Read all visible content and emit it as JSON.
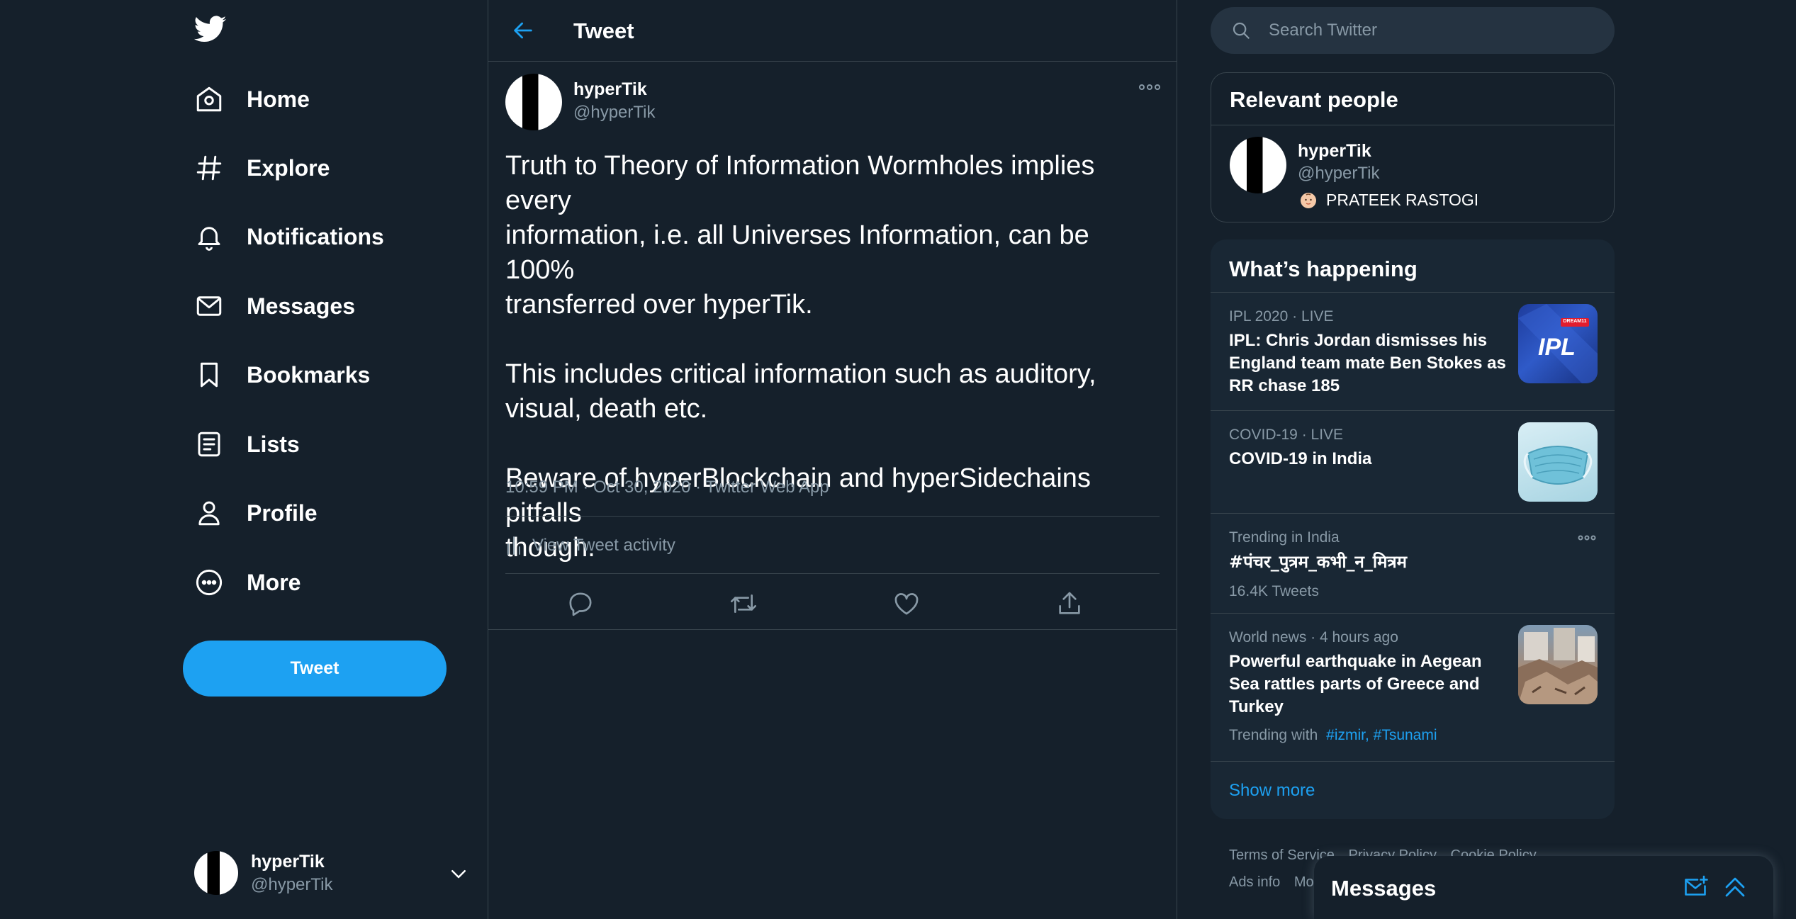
{
  "nav": {
    "items": [
      {
        "label": "Home",
        "icon": "home-icon"
      },
      {
        "label": "Explore",
        "icon": "hashtag-icon"
      },
      {
        "label": "Notifications",
        "icon": "bell-icon"
      },
      {
        "label": "Messages",
        "icon": "envelope-icon"
      },
      {
        "label": "Bookmarks",
        "icon": "bookmark-icon"
      },
      {
        "label": "Lists",
        "icon": "list-icon"
      },
      {
        "label": "Profile",
        "icon": "person-icon"
      },
      {
        "label": "More",
        "icon": "more-circle-icon"
      }
    ],
    "tweet_button": "Tweet",
    "account": {
      "name": "hyperTik",
      "handle": "@hyperTik"
    }
  },
  "center": {
    "title": "Tweet",
    "tweet": {
      "author_name": "hyperTik",
      "author_handle": "@hyperTik",
      "text": "Truth to Theory of Information Wormholes implies every\ninformation, i.e. all Universes Information, can be 100%\ntransferred over hyperTik.\n\nThis includes critical information such as auditory,\nvisual, death etc.\n\nBeware of hyperBlockchain and hyperSidechains pitfalls\nthough.",
      "meta": "10:59 PM · Oct 30, 2020 · Twitter Web App",
      "activity": "View Tweet activity"
    }
  },
  "right": {
    "search_placeholder": "Search Twitter",
    "relevant": {
      "title": "Relevant people",
      "name": "hyperTik",
      "handle": "@hyperTik",
      "bio": "PRATEEK RASTOGI"
    },
    "happening": {
      "title": "What’s happening",
      "trends": [
        {
          "context": "IPL 2020 · LIVE",
          "title": "IPL: Chris Jordan dismisses his England team mate Ben Stokes as RR chase 185",
          "thumb_text": "IPL",
          "thumb_badge": "DREAM11"
        },
        {
          "context": "COVID-19 · LIVE",
          "title": "COVID-19 in India"
        },
        {
          "context": "Trending in India",
          "title": "#पंचर_पुत्रम_कभी_न_मित्रम",
          "sub": "16.4K Tweets"
        },
        {
          "context": "World news · 4 hours ago",
          "title": "Powerful earthquake in Aegean Sea rattles parts of Greece and Turkey",
          "sub_prefix": "Trending with",
          "tags": "#izmir, #Tsunami"
        }
      ],
      "show_more": "Show more"
    },
    "footer": [
      "Terms of Service",
      "Privacy Policy",
      "Cookie Policy",
      "Ads info",
      "Mo"
    ]
  },
  "drawer": {
    "title": "Messages"
  },
  "colors": {
    "background": "#15202b",
    "accent": "#1da1f2",
    "secondary_text": "#8899a6",
    "border": "#38444d",
    "card": "#192734"
  }
}
